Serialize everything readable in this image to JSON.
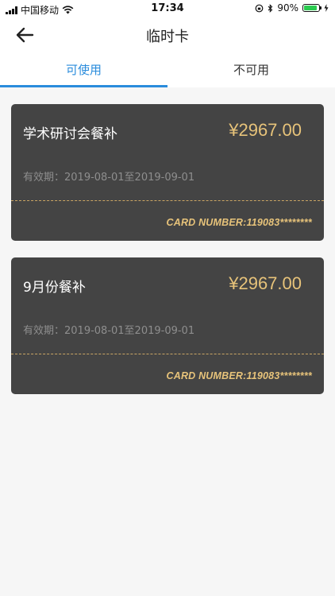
{
  "status_bar": {
    "carrier": "中国移动",
    "time": "17:34",
    "battery": "90%",
    "battery_level": 0.9
  },
  "header": {
    "title": "临时卡",
    "back_icon": "arrow-left-icon"
  },
  "tabs": [
    {
      "label": "可使用",
      "active": true
    },
    {
      "label": "不可用",
      "active": false
    }
  ],
  "cards": [
    {
      "name": "学术研讨会餐补",
      "amount": "¥2967.00",
      "validity": "有效期：2019-08-01至2019-09-01",
      "card_number": "CARD NUMBER:119083********"
    },
    {
      "name": "9月份餐补",
      "amount": "¥2967.00",
      "validity": "有效期：2019-08-01至2019-09-01",
      "card_number": "CARD NUMBER:119083********"
    }
  ],
  "colors": {
    "accent": "#2a8cdc",
    "card_bg": "#444444",
    "gold": "#e7c37a"
  }
}
